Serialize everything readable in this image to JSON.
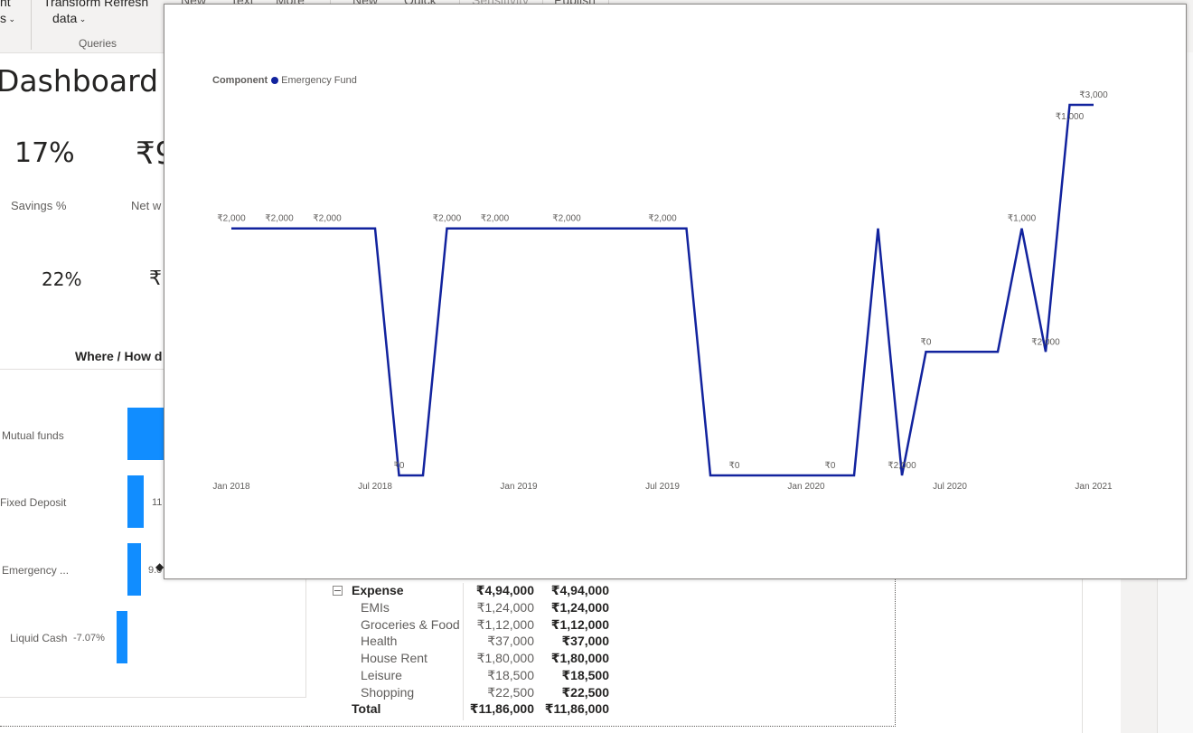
{
  "ribbon": {
    "cut_left_1": "nt",
    "cut_left_2": "s",
    "transform_label": "Transform",
    "refresh_label": "Refresh",
    "data_label": "data",
    "group_queries": "Queries",
    "cut_top_items": [
      "New",
      "Text",
      "More",
      "New",
      "Quick",
      "Sensitivity",
      "Publish"
    ]
  },
  "dashboard": {
    "title": "Dashboard",
    "kpis": [
      {
        "value": "17%",
        "label": "Savings %"
      },
      {
        "value": "₹9",
        "label": "Net w"
      },
      {
        "value": "22%",
        "label": ""
      },
      {
        "value": "₹",
        "label": ""
      }
    ],
    "section_title": "Where / How d",
    "bars": [
      {
        "label": "Mutual funds",
        "value_text": "",
        "value": 1.0
      },
      {
        "label": "Fixed Deposit",
        "value_text": "11",
        "value": 0.4
      },
      {
        "label": "Emergency ...",
        "value_text": "9.0",
        "value": 0.33
      },
      {
        "label": "Liquid Cash",
        "value_text": "-7.07%",
        "value": -0.26
      }
    ]
  },
  "matrix": {
    "group": {
      "label": "Expense",
      "v1": "₹4,94,000",
      "v2": "₹4,94,000"
    },
    "rows": [
      {
        "label": "EMIs",
        "v1": "₹1,24,000",
        "v2": "₹1,24,000"
      },
      {
        "label": "Groceries & Food",
        "v1": "₹1,12,000",
        "v2": "₹1,12,000"
      },
      {
        "label": "Health",
        "v1": "₹37,000",
        "v2": "₹37,000"
      },
      {
        "label": "House Rent",
        "v1": "₹1,80,000",
        "v2": "₹1,80,000"
      },
      {
        "label": "Leisure",
        "v1": "₹18,500",
        "v2": "₹18,500"
      },
      {
        "label": "Shopping",
        "v1": "₹22,500",
        "v2": "₹22,500"
      }
    ],
    "total": {
      "label": "Total",
      "v1": "₹11,86,000",
      "v2": "₹11,86,000"
    }
  },
  "chart_data": {
    "type": "line",
    "legend_title": "Component",
    "series": [
      {
        "name": "Emergency Fund",
        "color": "#12239e",
        "x": [
          "2018-01",
          "2018-02",
          "2018-03",
          "2018-04",
          "2018-05",
          "2018-06",
          "2018-07",
          "2018-08",
          "2018-09",
          "2018-10",
          "2018-11",
          "2018-12",
          "2019-01",
          "2019-02",
          "2019-03",
          "2019-04",
          "2019-05",
          "2019-06",
          "2019-07",
          "2019-08",
          "2019-09",
          "2019-10",
          "2019-11",
          "2019-12",
          "2020-01",
          "2020-02",
          "2020-03",
          "2020-04",
          "2020-05",
          "2020-06",
          "2020-07",
          "2020-08",
          "2020-09",
          "2020-10",
          "2020-11",
          "2020-12",
          "2021-01"
        ],
        "values": [
          2000,
          2000,
          2000,
          2000,
          2000,
          2000,
          2000,
          0,
          0,
          2000,
          2000,
          2000,
          2000,
          2000,
          2000,
          2000,
          2000,
          2000,
          2000,
          2000,
          0,
          0,
          0,
          0,
          0,
          0,
          0,
          2000,
          0,
          1000,
          1000,
          1000,
          1000,
          2000,
          1000,
          3000,
          3000
        ]
      }
    ],
    "x_ticks": [
      "Jan 2018",
      "Jul 2018",
      "Jan 2019",
      "Jul 2019",
      "Jan 2020",
      "Jul 2020",
      "Jan 2021"
    ],
    "data_labels": [
      "₹2,000",
      "₹2,000",
      "₹2,000",
      "₹0",
      "₹2,000",
      "₹2,000",
      "₹2,000",
      "₹2,000",
      "₹0",
      "₹0",
      "₹2,000",
      "₹0",
      "₹1,000",
      "₹2,000",
      "₹1,000",
      "₹3,000"
    ],
    "ylim": [
      0,
      3000
    ],
    "grid": false,
    "legend_position": "top-left"
  }
}
